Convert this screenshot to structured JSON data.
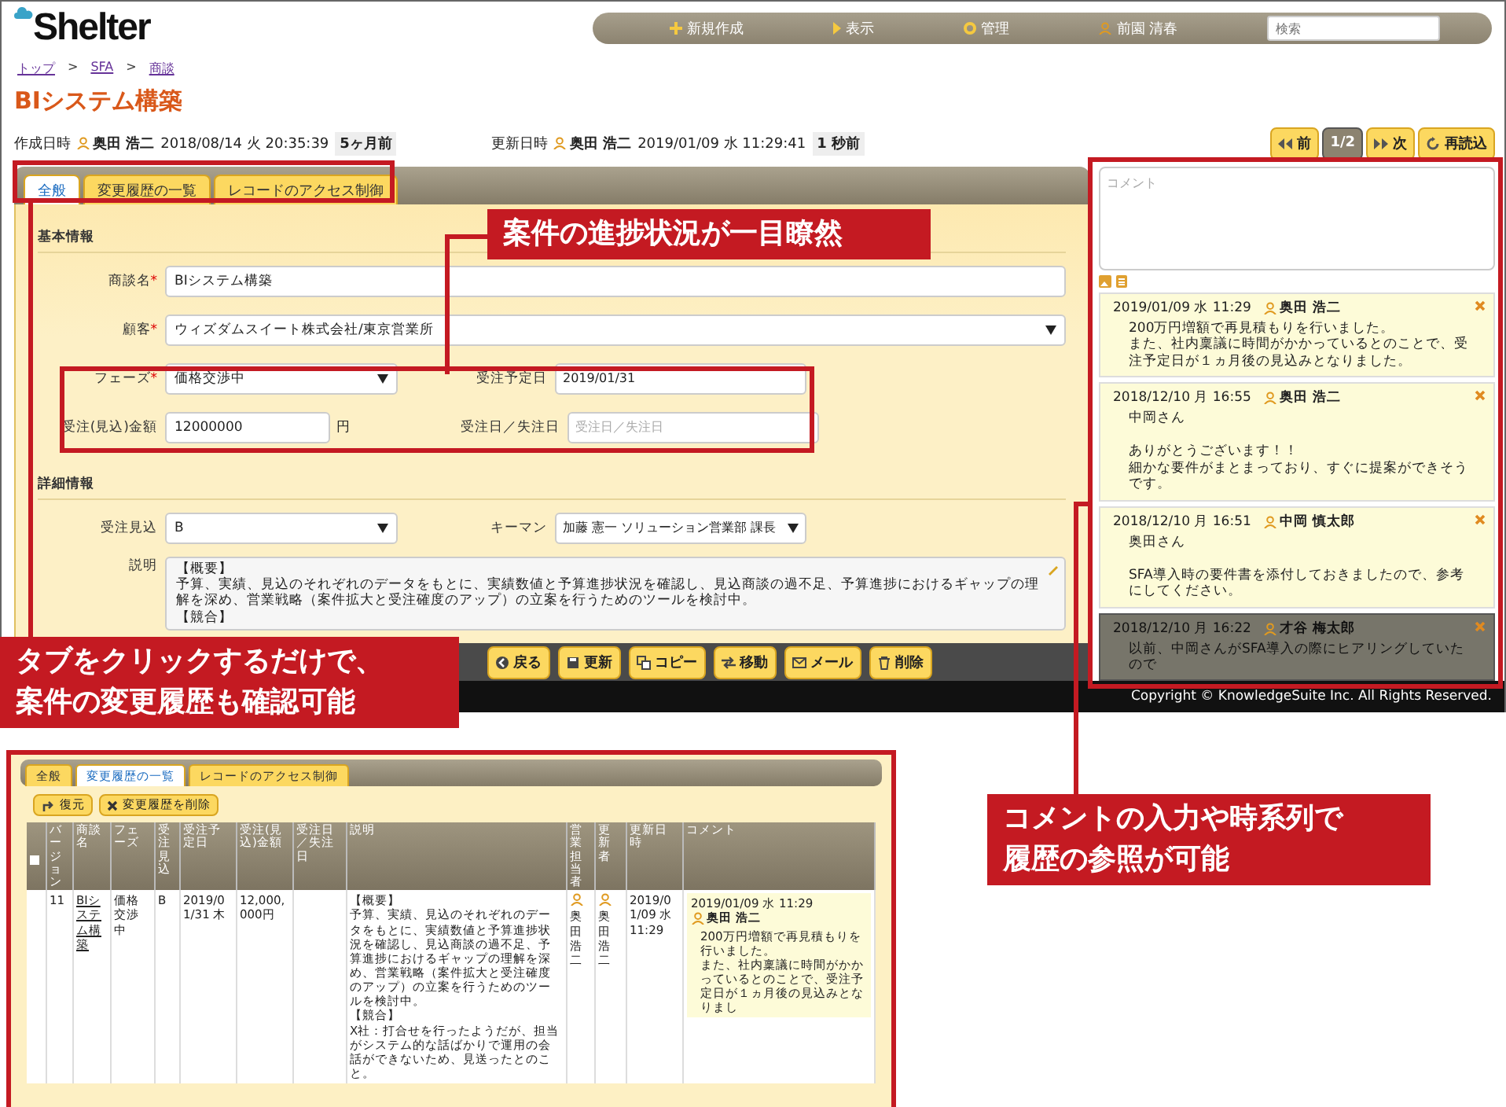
{
  "header": {
    "logo": "Shelter",
    "nav": [
      {
        "kind": "plus",
        "label": "新規作成"
      },
      {
        "kind": "arrow",
        "label": "表示"
      },
      {
        "kind": "gear",
        "label": "管理"
      },
      {
        "kind": "user",
        "label": "前園 清春"
      }
    ],
    "search": {
      "placeholder": "検索"
    }
  },
  "breadcrumb": {
    "separator": ">",
    "items": [
      "トップ",
      "SFA",
      "商談"
    ]
  },
  "title": "BIシステム構築",
  "meta": [
    {
      "label": "作成日時",
      "user": "奥田 浩二",
      "datetime": "2018/08/14 火 20:35:39",
      "ago": "5ヶ月前"
    },
    {
      "label": "更新日時",
      "user": "奥田 浩二",
      "datetime": "2019/01/09 水 11:29:41",
      "ago": "1 秒前"
    }
  ],
  "pager": [
    {
      "kind": "prev",
      "label": "前"
    },
    {
      "kind": "page",
      "label": "1/2"
    },
    {
      "kind": "next",
      "label": "次"
    },
    {
      "kind": "reload",
      "label": "再読込"
    }
  ],
  "tabs": [
    {
      "label": "全般",
      "selected": true
    },
    {
      "label": "変更履歴の一覧",
      "selected": false
    },
    {
      "label": "レコードのアクセス制御",
      "selected": false
    }
  ],
  "required_mark": "*",
  "sections": [
    {
      "title": "基本情報",
      "rows": [
        [
          {
            "kind": "text",
            "label": "商談名",
            "required": true,
            "value": "BIシステム構築"
          }
        ],
        [
          {
            "kind": "select",
            "label": "顧客",
            "required": true,
            "value": "ウィズダムスイート株式会社/東京営業所"
          }
        ],
        [
          {
            "kind": "select",
            "label": "フェーズ",
            "required": true,
            "value": "価格交渉中"
          },
          {
            "kind": "text",
            "label": "受注予定日",
            "required": false,
            "value": "2019/01/31"
          }
        ],
        [
          {
            "kind": "text",
            "label": "受注(見込)金額",
            "required": false,
            "value": "12000000",
            "unit": "円"
          },
          {
            "kind": "text",
            "label": "受注日／失注日",
            "required": false,
            "placeholder": "受注日／失注日"
          }
        ]
      ]
    },
    {
      "title": "詳細情報",
      "rows": [
        [
          {
            "kind": "select",
            "label": "受注見込",
            "required": false,
            "value": "B"
          },
          {
            "kind": "select",
            "label": "キーマン",
            "required": false,
            "value": "加藤 憲一 ソリューション営業部 課長"
          }
        ],
        [
          {
            "kind": "textarea",
            "label": "説明",
            "required": false,
            "lines": [
              "【概要】",
              "予算、実績、見込のそれぞれのデータをもとに、実績数値と予算進捗状況を確認し、見込商談の過不足、予算進捗におけるギャップの理解を深め、営業戦略（案件拡大と受注確度のアップ）の立案を行うためのツールを検討中。",
              "【競合】"
            ]
          }
        ]
      ]
    }
  ],
  "actions": [
    {
      "kind": "back",
      "label": "戻る"
    },
    {
      "kind": "save",
      "label": "更新"
    },
    {
      "kind": "copy",
      "label": "コピー"
    },
    {
      "kind": "move",
      "label": "移動"
    },
    {
      "kind": "mail",
      "label": "メール"
    },
    {
      "kind": "delete",
      "label": "削除"
    }
  ],
  "comments": {
    "placeholder": "コメント",
    "items": [
      {
        "datetime": "2019/01/09 水 11:29",
        "author": "奥田 浩二",
        "paragraphs": [
          [
            "200万円増額で再見積もりを行いました。",
            "また、社内稟議に時間がかかっているとのことで、受注予定日が１ヵ月後の見込みとなりました。"
          ]
        ]
      },
      {
        "datetime": "2018/12/10 月 16:55",
        "author": "奥田 浩二",
        "paragraphs": [
          [
            "中岡さん"
          ],
          [
            "ありがとうございます！！",
            "細かな要件がまとまっており、すぐに提案ができそうです。"
          ]
        ]
      },
      {
        "datetime": "2018/12/10 月 16:51",
        "author": "中岡 慎太郎",
        "paragraphs": [
          [
            "奥田さん"
          ],
          [
            "SFA導入時の要件書を添付しておきましたので、参考にしてください。"
          ]
        ]
      },
      {
        "datetime": "2018/12/10 月 16:22",
        "author": "才谷 梅太郎",
        "paragraphs": [
          [
            "以前、中岡さんがSFA導入の際にヒアリングしていたので"
          ]
        ]
      }
    ]
  },
  "footer": "Copyright © KnowledgeSuite Inc. All Rights Reserved.",
  "inset": {
    "tabs": [
      {
        "label": "全般",
        "selected": false
      },
      {
        "label": "変更履歴の一覧",
        "selected": true
      },
      {
        "label": "レコードのアクセス制御",
        "selected": false
      }
    ],
    "buttons": [
      {
        "kind": "restore",
        "label": "復元"
      },
      {
        "kind": "delete",
        "label": "変更履歴を削除"
      }
    ],
    "table": {
      "checked": false,
      "columns": [
        "バージョン",
        "商談名",
        "フェーズ",
        "受注見込",
        "受注予定日",
        "受注(見込)金額",
        "受注日／失注日",
        "説明",
        "営業担当者",
        "更新者",
        "更新日時",
        "コメント"
      ],
      "rows": [
        {
          "version": "11",
          "name": "BIシステム構築",
          "phase": "価格交渉中",
          "forecast": "B",
          "due": "2019/01/31 木",
          "amount": "12,000,000円",
          "description": [
            "【概要】",
            "予算、実績、見込のそれぞれのデータをもとに、実績数値と予算進捗状況を確認し、見込商談の過不足、予算進捗におけるギャップの理解を深め、営業戦略（案件拡大と受注確度のアップ）の立案を行うためのツールを検討中。",
            "【競合】",
            "X社：打合せを行ったようだが、担当がシステム的な話ばかりで運用の会話ができないため、見送ったとのこと。"
          ],
          "owner": "奥田浩二",
          "updater": "奥田浩二",
          "updated": "2019/01/09 水 11:29",
          "comment": {
            "datetime": "2019/01/09 水 11:29",
            "author": "奥田 浩二",
            "lines": [
              "200万円増額で再見積もりを行いました。",
              "また、社内稟議に時間がかかっているとのことで、受注予定日が１ヵ月後の見込みとなりまし"
            ]
          }
        }
      ]
    }
  },
  "callouts": [
    {
      "kind": "progress",
      "lines": [
        "案件の進捗状況が一目瞭然"
      ]
    },
    {
      "kind": "tabs",
      "lines": [
        "タブをクリックするだけで、",
        "案件の変更履歴も確認可能"
      ]
    },
    {
      "kind": "comments",
      "lines": [
        "コメントの入力や時系列で",
        "履歴の参照が可能"
      ]
    }
  ]
}
